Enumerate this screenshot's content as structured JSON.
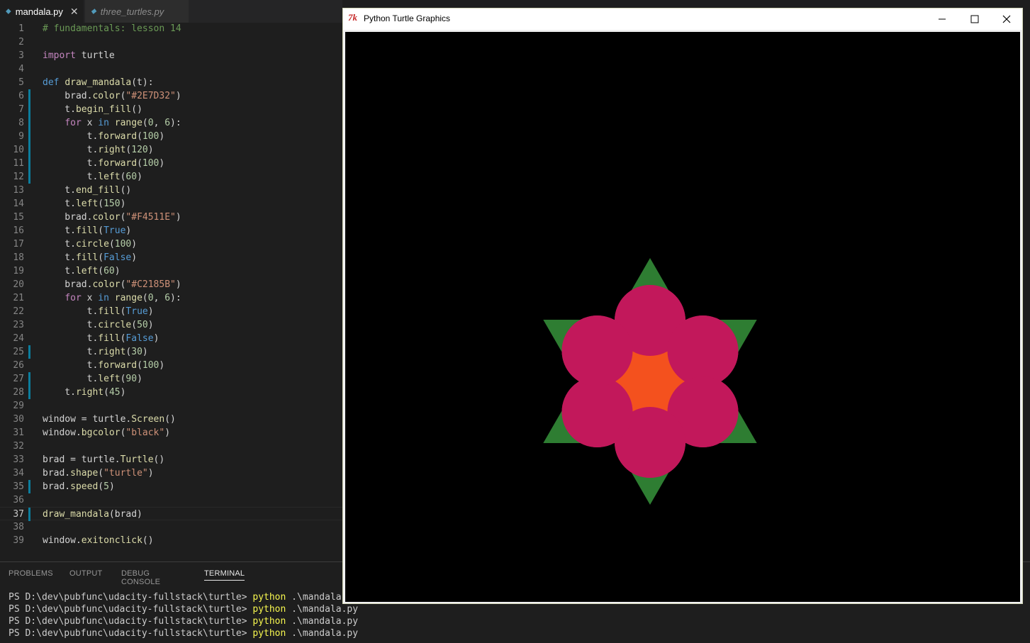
{
  "editor": {
    "tabs": [
      {
        "label": "mandala.py",
        "active": true,
        "close": "✕"
      },
      {
        "label": "three_turtles.py",
        "active": false
      }
    ],
    "current_line": 37,
    "modified_lines": [
      6,
      7,
      8,
      9,
      10,
      11,
      12,
      25,
      27,
      28,
      35,
      37
    ],
    "lines": [
      "# fundamentals: lesson 14",
      "",
      "import turtle",
      "",
      "def draw_mandala(t):",
      "    brad.color(\"#2E7D32\")",
      "    t.begin_fill()",
      "    for x in range(0, 6):",
      "        t.forward(100)",
      "        t.right(120)",
      "        t.forward(100)",
      "        t.left(60)",
      "    t.end_fill()",
      "    t.left(150)",
      "    brad.color(\"#F4511E\")",
      "    t.fill(True)",
      "    t.circle(100)",
      "    t.fill(False)",
      "    t.left(60)",
      "    brad.color(\"#C2185B\")",
      "    for x in range(0, 6):",
      "        t.fill(True)",
      "        t.circle(50)",
      "        t.fill(False)",
      "        t.right(30)",
      "        t.forward(100)",
      "        t.left(90)",
      "    t.right(45)",
      "",
      "window = turtle.Screen()",
      "window.bgcolor(\"black\")",
      "",
      "brad = turtle.Turtle()",
      "brad.shape(\"turtle\")",
      "brad.speed(5)",
      "",
      "draw_mandala(brad)",
      "",
      "window.exitonclick()"
    ]
  },
  "panel": {
    "tabs": [
      "PROBLEMS",
      "OUTPUT",
      "DEBUG CONSOLE",
      "TERMINAL"
    ],
    "active_tab": "TERMINAL",
    "terminal_lines": [
      {
        "prompt": "PS D:\\dev\\pubfunc\\udacity-fullstack\\turtle> ",
        "cmd": "python",
        "args": " .\\mandala.py"
      },
      {
        "prompt": "PS D:\\dev\\pubfunc\\udacity-fullstack\\turtle> ",
        "cmd": "python",
        "args": " .\\mandala.py"
      },
      {
        "prompt": "PS D:\\dev\\pubfunc\\udacity-fullstack\\turtle> ",
        "cmd": "python",
        "args": " .\\mandala.py"
      },
      {
        "prompt": "PS D:\\dev\\pubfunc\\udacity-fullstack\\turtle> ",
        "cmd": "python",
        "args": " .\\mandala.py"
      }
    ]
  },
  "turtle_window": {
    "title": "Python Turtle Graphics",
    "icon": "tk-feather-icon",
    "buttons": [
      "minimize",
      "maximize",
      "close"
    ],
    "canvas_bg": "#000000",
    "colors": {
      "star": "#2E7D32",
      "center": "#F4511E",
      "petals": "#C2185B"
    }
  },
  "colors": {
    "keyword": "#569cd6",
    "control": "#c586c0",
    "string": "#ce9178",
    "number": "#b5cea8",
    "comment": "#6a9955",
    "function": "#dcdcaa",
    "bool": "#569cd6"
  }
}
